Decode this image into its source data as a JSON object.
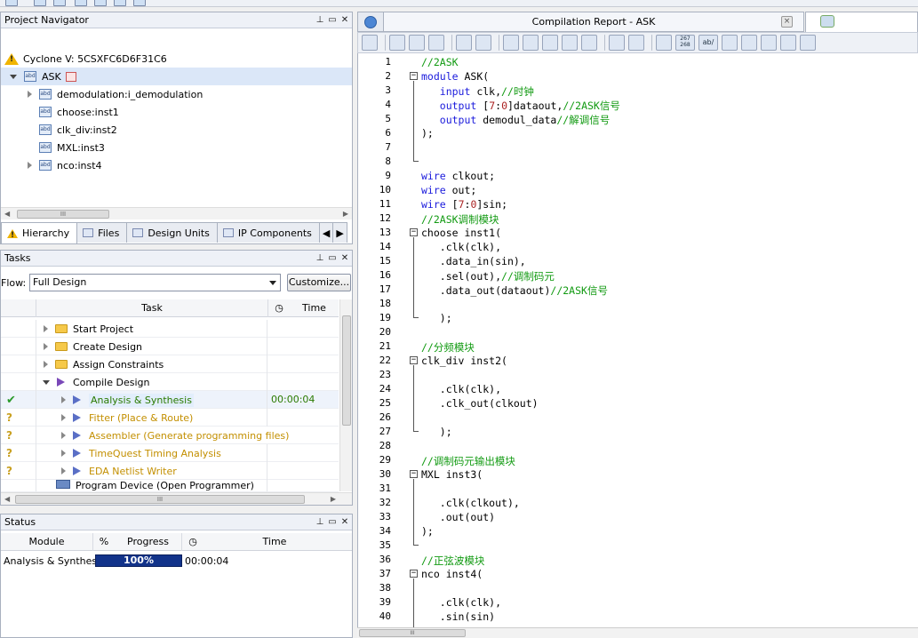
{
  "project_navigator": {
    "title": "Project Navigator",
    "device": "Cyclone V: 5CSXFC6D6F31C6",
    "top_entity": "ASK",
    "instances": [
      "demodulation:i_demodulation",
      "choose:inst1",
      "clk_div:inst2",
      "MXL:inst3",
      "nco:inst4"
    ],
    "scroll_mark": "III",
    "tabs": [
      "Hierarchy",
      "Files",
      "Design Units",
      "IP Components"
    ]
  },
  "tasks": {
    "title": "Tasks",
    "flow_label": "Flow:",
    "flow_value": "Full Design",
    "customize_label": "Customize...",
    "col_task": "Task",
    "col_time": "Time",
    "rows": [
      {
        "label": "Start Project",
        "time": ""
      },
      {
        "label": "Create Design",
        "time": ""
      },
      {
        "label": "Assign Constraints",
        "time": ""
      },
      {
        "label": "Compile Design",
        "time": ""
      },
      {
        "label": "Analysis & Synthesis",
        "time": "00:00:04"
      },
      {
        "label": "Fitter (Place & Route)",
        "time": ""
      },
      {
        "label": "Assembler (Generate programming files)",
        "time": ""
      },
      {
        "label": "TimeQuest Timing Analysis",
        "time": ""
      },
      {
        "label": "EDA Netlist Writer",
        "time": ""
      },
      {
        "label": "Program Device (Open Programmer)",
        "time": ""
      }
    ],
    "scroll_mark": "III"
  },
  "status": {
    "title": "Status",
    "col_module": "Module",
    "col_percent": "%",
    "col_progress": "Progress",
    "col_time": "Time",
    "row": {
      "module": "Analysis & Synthesis",
      "progress": "100%",
      "progress_fraction": 1.0,
      "time": "00:00:04"
    }
  },
  "editor": {
    "report_tab": "Compilation Report - ASK",
    "close_glyph": "×",
    "toolbar_badge": "267\n268",
    "toolbar_ab": "ab/",
    "line_numbers": [
      "1",
      "2",
      "3",
      "4",
      "5",
      "6",
      "7",
      "8",
      "9",
      "10",
      "11",
      "12",
      "13",
      "14",
      "15",
      "16",
      "17",
      "18",
      "19",
      "20",
      "21",
      "22",
      "23",
      "24",
      "25",
      "26",
      "27",
      "28",
      "29",
      "30",
      "31",
      "32",
      "33",
      "34",
      "35",
      "36",
      "37",
      "38",
      "39",
      "40"
    ],
    "lines": {
      "l1": "//2ASK",
      "l2_kw": "module",
      "l2_rest": " ASK(",
      "l3_kw": "input",
      "l3_rest": " clk,",
      "l3_cm": "//时钟",
      "l4_kw": "output",
      "l4_b1": " [",
      "l4_n1": "7",
      "l4_b2": ":",
      "l4_n2": "0",
      "l4_b3": "]dataout,",
      "l4_cm": "//2ASK信号",
      "l5_kw": "output",
      "l5_rest": " demodul_data",
      "l5_cm": "//解调信号",
      "l6": ");",
      "l9_kw": "wire",
      "l9_rest": " clkout;",
      "l10_kw": "wire",
      "l10_rest": " out;",
      "l11_kw": "wire",
      "l11_b1": " [",
      "l11_n1": "7",
      "l11_b2": ":",
      "l11_n2": "0",
      "l11_b3": "]sin;",
      "l12": "//2ASK调制模块",
      "l13": "choose inst1(",
      "l14": ".clk(clk),",
      "l15": ".data_in(sin),",
      "l16": ".sel(out),",
      "l16_cm": "//调制码元",
      "l17": ".data_out(dataout)",
      "l17_cm": "//2ASK信号",
      "l19": ");",
      "l21": "//分频模块",
      "l22": "clk_div inst2(",
      "l24": ".clk(clk),",
      "l25": ".clk_out(clkout)",
      "l27": ");",
      "l29": "//调制码元输出模块",
      "l30": "MXL inst3(",
      "l32": ".clk(clkout),",
      "l33": ".out(out)",
      "l34": ");",
      "l36": "//正弦波模块",
      "l37": "nco inst4(",
      "l39": ".clk(clk),",
      "l40": ".sin(sin)"
    }
  }
}
